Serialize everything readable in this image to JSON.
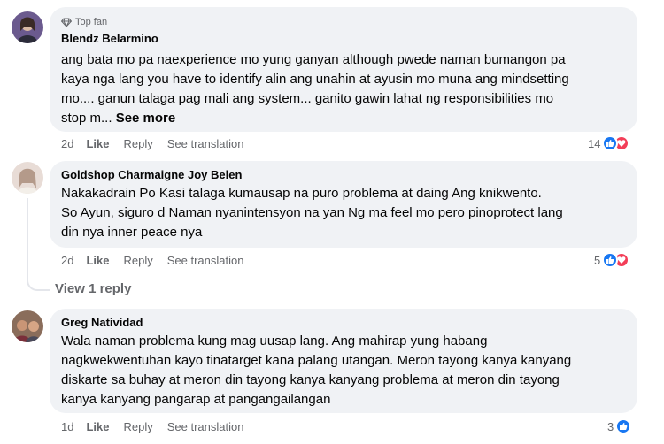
{
  "comments": [
    {
      "author": "Blendz Belarmino",
      "badge": "Top fan",
      "lines": [
        "ang bata mo pa naexperience mo yung ganyan although pwede naman bumangon pa",
        "kaya nga lang you have to identify alin ang unahin at ayusin mo muna ang mindsetting",
        "mo.... ganun talaga pag mali ang system... ganito gawin lahat ng responsibilities mo",
        "stop m..."
      ],
      "see_more": "See more",
      "time": "2d",
      "like": "Like",
      "reply": "Reply",
      "translate": "See translation",
      "reaction_count": "14"
    },
    {
      "author": "Goldshop Charmaigne Joy Belen",
      "lines": [
        "Nakakadrain Po Kasi talaga kumausap na puro problema at daing Ang knikwento.",
        "So Ayun, siguro d Naman nyanintensyon na yan Ng ma feel mo pero pinoprotect lang",
        "din nya inner peace nya"
      ],
      "time": "2d",
      "like": "Like",
      "reply": "Reply",
      "translate": "See translation",
      "reaction_count": "5"
    },
    {
      "author": "Greg Natividad",
      "lines": [
        "Wala naman problema kung mag uusap lang. Ang mahirap yung habang",
        "nagkwekwentuhan kayo tinatarget kana palang utangan. Meron tayong kanya kanyang",
        "diskarte sa buhay at meron din tayong kanya kanyang problema at meron din tayong",
        "kanya kanyang pangarap at pangangailangan"
      ],
      "time": "1d",
      "like": "Like",
      "reply": "Reply",
      "translate": "See translation",
      "reaction_count": "3"
    }
  ],
  "view_replies": "View 1 reply",
  "colors": {
    "like": "#1877f2",
    "love": "#f33e58",
    "bubble": "#f0f2f5",
    "meta": "#65676b"
  }
}
